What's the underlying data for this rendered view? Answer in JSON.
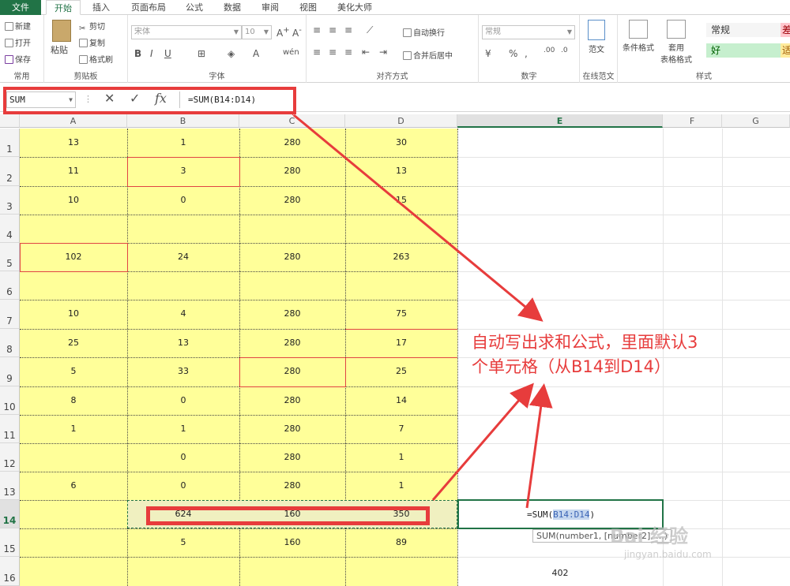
{
  "tabs": [
    "文件",
    "开始",
    "插入",
    "页面布局",
    "公式",
    "数据",
    "审阅",
    "视图",
    "美化大师"
  ],
  "ribbon": {
    "common": {
      "title": "常用",
      "new": "新建",
      "open": "打开",
      "save": "保存"
    },
    "clipboard": {
      "title": "剪贴板",
      "paste": "粘贴",
      "cut": "剪切",
      "copy": "复制",
      "format_painter": "格式刷"
    },
    "font": {
      "title": "字体",
      "font_name": "宋体",
      "font_size": "10"
    },
    "alignment": {
      "title": "对齐方式",
      "wrap_text": "自动换行",
      "merge_center": "合并后居中"
    },
    "number": {
      "title": "数字",
      "format": "常规"
    },
    "template": {
      "title": "在线范文",
      "label": "范文"
    },
    "styles": {
      "title": "样式",
      "conditional": "条件格式",
      "table_format_1": "套用",
      "table_format_2": "表格格式",
      "normal": "常规",
      "good": "好",
      "bad_partial": "差",
      "neutral_partial": "适"
    }
  },
  "formula_bar": {
    "name_box": "SUM",
    "formula": "=SUM(B14:D14)"
  },
  "columns": [
    "A",
    "B",
    "C",
    "D",
    "E",
    "F",
    "G"
  ],
  "rows": [
    "1",
    "2",
    "3",
    "4",
    "5",
    "6",
    "7",
    "8",
    "9",
    "10",
    "11",
    "12",
    "13",
    "14",
    "15",
    "16"
  ],
  "cells": {
    "r1": [
      "13",
      "1",
      "280",
      "30"
    ],
    "r2": [
      "11",
      "3",
      "280",
      "13"
    ],
    "r3": [
      "10",
      "0",
      "280",
      "15"
    ],
    "r4": [
      "",
      "",
      "",
      ""
    ],
    "r5": [
      "102",
      "24",
      "280",
      "263"
    ],
    "r6": [
      "",
      "",
      "",
      ""
    ],
    "r7": [
      "10",
      "4",
      "280",
      "75"
    ],
    "r8": [
      "25",
      "13",
      "280",
      "17"
    ],
    "r9": [
      "5",
      "33",
      "280",
      "25"
    ],
    "r10": [
      "8",
      "0",
      "280",
      "14"
    ],
    "r11": [
      "1",
      "1",
      "280",
      "7"
    ],
    "r12": [
      "",
      "0",
      "280",
      "1"
    ],
    "r13": [
      "6",
      "0",
      "280",
      "1"
    ],
    "r14": [
      "",
      "624",
      "160",
      "350"
    ],
    "r15": [
      "",
      "5",
      "160",
      "89"
    ],
    "r16": [
      "",
      "",
      "",
      ""
    ]
  },
  "edit": {
    "prefix": "=SUM(",
    "ref": "B14:D14",
    "suffix": ")",
    "tooltip": "SUM(number1, [number2], ...)",
    "e16_value": "402"
  },
  "annotation": {
    "line1": "自动写出求和公式，里面默认3",
    "line2": "个单元格（从B14到D14）"
  },
  "watermark": {
    "brand": "Bai 经验",
    "url": "jingyan.baidu.com"
  },
  "colors": {
    "accent": "#217346",
    "annotation_red": "#e73c3c",
    "cell_fill": "#ffff99"
  }
}
